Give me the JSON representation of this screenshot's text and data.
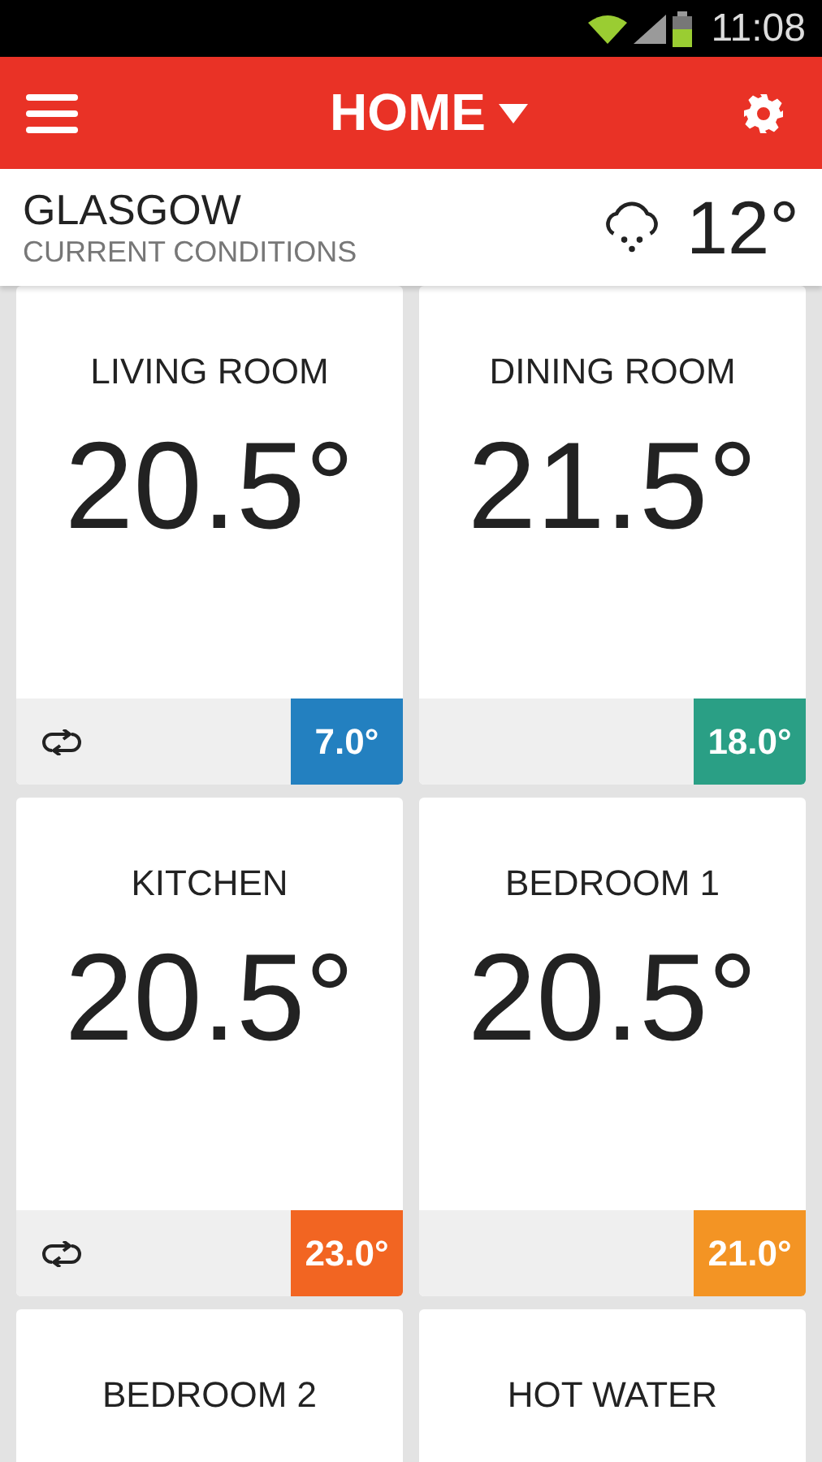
{
  "status_bar": {
    "time": "11:08"
  },
  "app_bar": {
    "title": "HOME"
  },
  "weather": {
    "location": "GLASGOW",
    "subtitle": "CURRENT CONDITIONS",
    "temperature": "12°"
  },
  "zones": [
    {
      "name": "LIVING ROOM",
      "temperature": "20.5°",
      "scheduled": true,
      "setpoint": "7.0°",
      "color": "#2380c0"
    },
    {
      "name": "DINING ROOM",
      "temperature": "21.5°",
      "scheduled": false,
      "setpoint": "18.0°",
      "color": "#2a9f85"
    },
    {
      "name": "KITCHEN",
      "temperature": "20.5°",
      "scheduled": true,
      "setpoint": "23.0°",
      "color": "#f26522"
    },
    {
      "name": "BEDROOM 1",
      "temperature": "20.5°",
      "scheduled": false,
      "setpoint": "21.0°",
      "color": "#f39424"
    },
    {
      "name": "BEDROOM 2"
    },
    {
      "name": "HOT WATER"
    }
  ]
}
